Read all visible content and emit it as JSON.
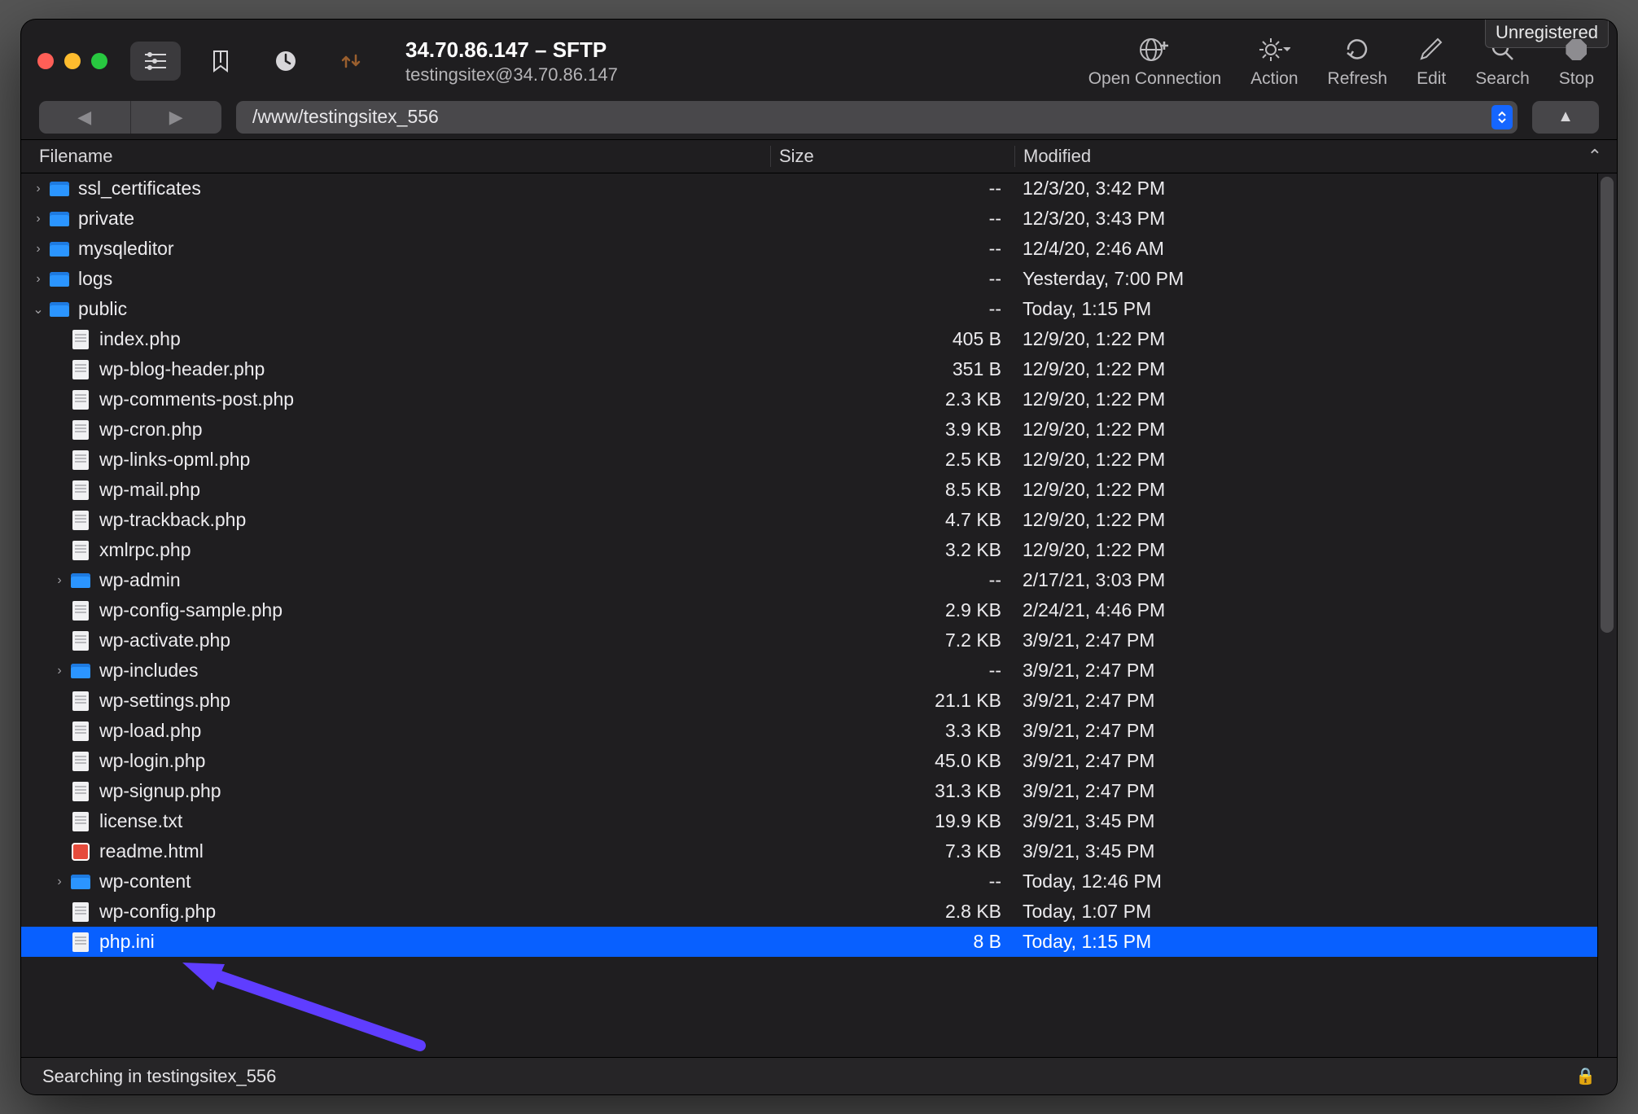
{
  "badge_unregistered": "Unregistered",
  "title": {
    "main": "34.70.86.147 – SFTP",
    "sub": "testingsitex@34.70.86.147"
  },
  "toolbar_actions": {
    "open_connection": "Open Connection",
    "action": "Action",
    "refresh": "Refresh",
    "edit": "Edit",
    "search": "Search",
    "stop": "Stop"
  },
  "path": "/www/testingsitex_556",
  "columns": {
    "filename": "Filename",
    "size": "Size",
    "modified": "Modified"
  },
  "rows": [
    {
      "depth": 0,
      "expand": "›",
      "type": "folder",
      "name": "ssl_certificates",
      "size": "--",
      "mod": "12/3/20, 3:42 PM"
    },
    {
      "depth": 0,
      "expand": "›",
      "type": "folder",
      "name": "private",
      "size": "--",
      "mod": "12/3/20, 3:43 PM"
    },
    {
      "depth": 0,
      "expand": "›",
      "type": "folder",
      "name": "mysqleditor",
      "size": "--",
      "mod": "12/4/20, 2:46 AM"
    },
    {
      "depth": 0,
      "expand": "›",
      "type": "folder",
      "name": "logs",
      "size": "--",
      "mod": "Yesterday, 7:00 PM"
    },
    {
      "depth": 0,
      "expand": "⌄",
      "type": "folder",
      "name": "public",
      "size": "--",
      "mod": "Today, 1:15 PM"
    },
    {
      "depth": 1,
      "expand": "",
      "type": "file",
      "name": "index.php",
      "size": "405 B",
      "mod": "12/9/20, 1:22 PM"
    },
    {
      "depth": 1,
      "expand": "",
      "type": "file",
      "name": "wp-blog-header.php",
      "size": "351 B",
      "mod": "12/9/20, 1:22 PM"
    },
    {
      "depth": 1,
      "expand": "",
      "type": "file",
      "name": "wp-comments-post.php",
      "size": "2.3 KB",
      "mod": "12/9/20, 1:22 PM"
    },
    {
      "depth": 1,
      "expand": "",
      "type": "file",
      "name": "wp-cron.php",
      "size": "3.9 KB",
      "mod": "12/9/20, 1:22 PM"
    },
    {
      "depth": 1,
      "expand": "",
      "type": "file",
      "name": "wp-links-opml.php",
      "size": "2.5 KB",
      "mod": "12/9/20, 1:22 PM"
    },
    {
      "depth": 1,
      "expand": "",
      "type": "file",
      "name": "wp-mail.php",
      "size": "8.5 KB",
      "mod": "12/9/20, 1:22 PM"
    },
    {
      "depth": 1,
      "expand": "",
      "type": "file",
      "name": "wp-trackback.php",
      "size": "4.7 KB",
      "mod": "12/9/20, 1:22 PM"
    },
    {
      "depth": 1,
      "expand": "",
      "type": "file",
      "name": "xmlrpc.php",
      "size": "3.2 KB",
      "mod": "12/9/20, 1:22 PM"
    },
    {
      "depth": 1,
      "expand": "›",
      "type": "folder",
      "name": "wp-admin",
      "size": "--",
      "mod": "2/17/21, 3:03 PM"
    },
    {
      "depth": 1,
      "expand": "",
      "type": "file",
      "name": "wp-config-sample.php",
      "size": "2.9 KB",
      "mod": "2/24/21, 4:46 PM"
    },
    {
      "depth": 1,
      "expand": "",
      "type": "file",
      "name": "wp-activate.php",
      "size": "7.2 KB",
      "mod": "3/9/21, 2:47 PM"
    },
    {
      "depth": 1,
      "expand": "›",
      "type": "folder",
      "name": "wp-includes",
      "size": "--",
      "mod": "3/9/21, 2:47 PM"
    },
    {
      "depth": 1,
      "expand": "",
      "type": "file",
      "name": "wp-settings.php",
      "size": "21.1 KB",
      "mod": "3/9/21, 2:47 PM"
    },
    {
      "depth": 1,
      "expand": "",
      "type": "file",
      "name": "wp-load.php",
      "size": "3.3 KB",
      "mod": "3/9/21, 2:47 PM"
    },
    {
      "depth": 1,
      "expand": "",
      "type": "file",
      "name": "wp-login.php",
      "size": "45.0 KB",
      "mod": "3/9/21, 2:47 PM"
    },
    {
      "depth": 1,
      "expand": "",
      "type": "file",
      "name": "wp-signup.php",
      "size": "31.3 KB",
      "mod": "3/9/21, 2:47 PM"
    },
    {
      "depth": 1,
      "expand": "",
      "type": "file",
      "name": "license.txt",
      "size": "19.9 KB",
      "mod": "3/9/21, 3:45 PM"
    },
    {
      "depth": 1,
      "expand": "",
      "type": "html",
      "name": "readme.html",
      "size": "7.3 KB",
      "mod": "3/9/21, 3:45 PM"
    },
    {
      "depth": 1,
      "expand": "›",
      "type": "folder",
      "name": "wp-content",
      "size": "--",
      "mod": "Today, 12:46 PM"
    },
    {
      "depth": 1,
      "expand": "",
      "type": "file",
      "name": "wp-config.php",
      "size": "2.8 KB",
      "mod": "Today, 1:07 PM"
    },
    {
      "depth": 1,
      "expand": "",
      "type": "file",
      "name": "php.ini",
      "size": "8 B",
      "mod": "Today, 1:15 PM",
      "selected": true
    }
  ],
  "status": "Searching in testingsitex_556"
}
